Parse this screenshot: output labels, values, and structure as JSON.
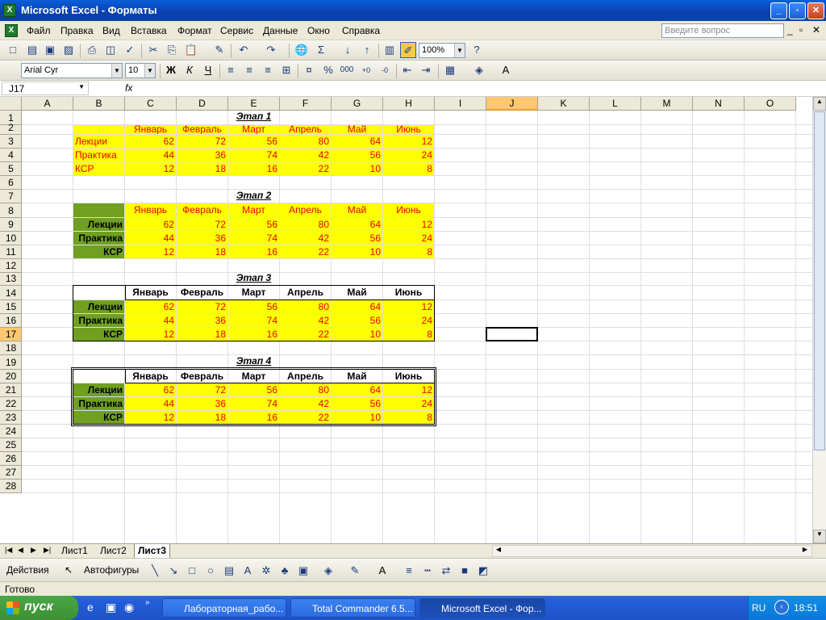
{
  "window": {
    "title": "Microsoft Excel - Форматы"
  },
  "menu": [
    "Файл",
    "Правка",
    "Вид",
    "Вставка",
    "Формат",
    "Сервис",
    "Данные",
    "Окно",
    "Справка"
  ],
  "ask_placeholder": "Введите вопрос",
  "toolbar": {
    "zoom": "100%"
  },
  "format_toolbar": {
    "font": "Arial Cyr",
    "size": "10",
    "bold": "Ж",
    "italic": "К",
    "underline": "Ч"
  },
  "formula": {
    "name_box": "J17",
    "fx": "fx",
    "value": ""
  },
  "columns": [
    "A",
    "B",
    "C",
    "D",
    "E",
    "F",
    "G",
    "H",
    "I",
    "J",
    "K",
    "L",
    "M",
    "N",
    "O"
  ],
  "rows": [
    "1",
    "2",
    "3",
    "4",
    "5",
    "6",
    "7",
    "8",
    "9",
    "10",
    "11",
    "12",
    "13",
    "14",
    "15",
    "16",
    "17",
    "18",
    "19",
    "20",
    "21",
    "22",
    "23",
    "24",
    "25",
    "26",
    "27",
    "28"
  ],
  "months": [
    "Январь",
    "Февраль",
    "Март",
    "Апрель",
    "Май",
    "Июнь"
  ],
  "categories": [
    "Лекции",
    "Практика",
    "КСР"
  ],
  "values": [
    [
      62,
      72,
      56,
      80,
      64,
      12
    ],
    [
      44,
      36,
      74,
      42,
      56,
      24
    ],
    [
      12,
      18,
      16,
      22,
      10,
      8
    ]
  ],
  "stages": [
    "Этап 1",
    "Этап 2",
    "Этап 3",
    "Этап 4"
  ],
  "sheets": [
    "Лист1",
    "Лист2",
    "Лист3"
  ],
  "active_sheet": "Лист3",
  "drawing": {
    "actions": "Действия",
    "autoshapes": "Автофигуры"
  },
  "status": "Готово",
  "taskbar": {
    "start": "пуск",
    "tasks": [
      "Лабораторная_рабо...",
      "Total Commander 6.5...",
      "Microsoft Excel - Фор..."
    ],
    "lang": "RU",
    "time": "18:51"
  }
}
